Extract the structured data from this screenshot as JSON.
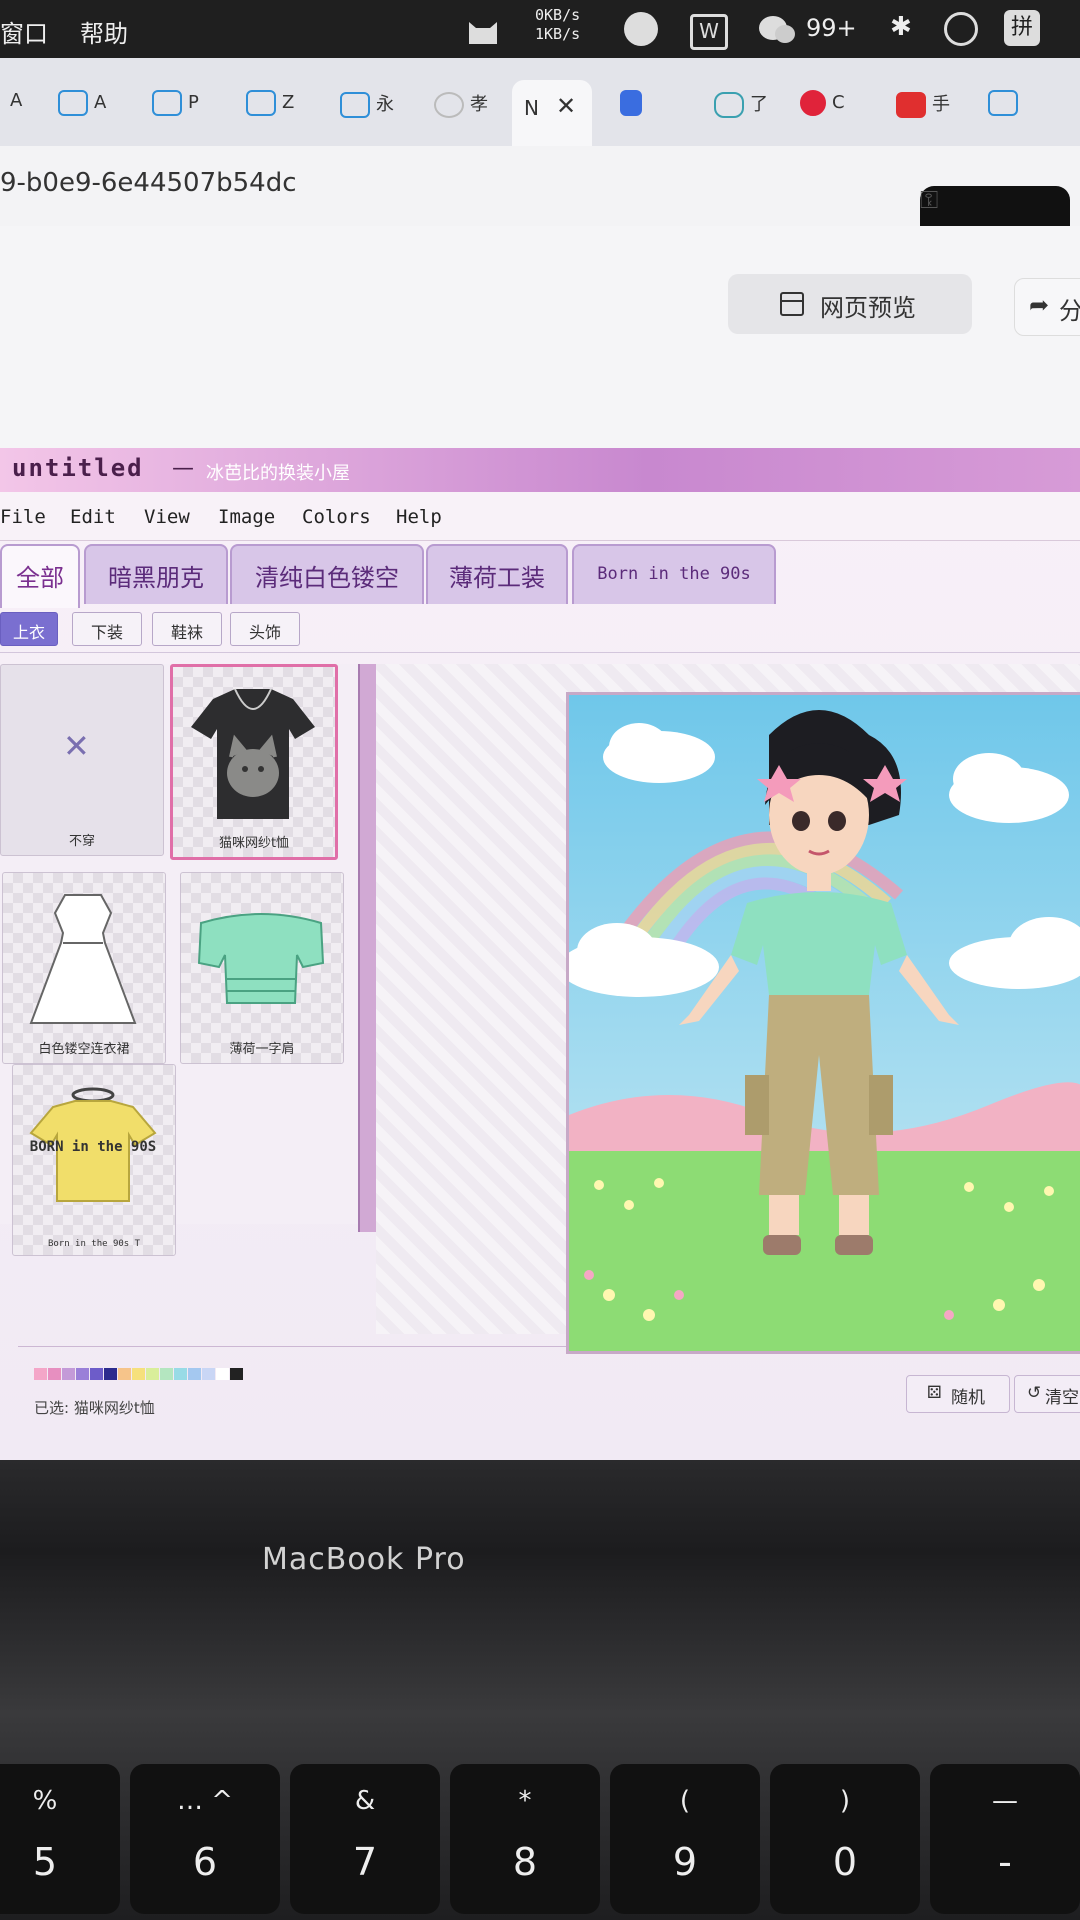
{
  "os_menu": {
    "window": "窗口",
    "help": "帮助",
    "net_up": "0KB/s",
    "net_down": "1KB/s",
    "wechat_badge": "99+",
    "ime": "拼"
  },
  "browser": {
    "tabs": [
      "A",
      "P",
      "Z",
      "永",
      "孝",
      "了",
      "C",
      "手"
    ],
    "active_tab": "N",
    "url": "9-b0e9-6e44507b54dc",
    "preview_button": "网页预览",
    "share_button": "分"
  },
  "app": {
    "title": "untitled",
    "dash": "—",
    "subtitle": "冰芭比的换装小屋",
    "menus": [
      "File",
      "Edit",
      "View",
      "Image",
      "Colors",
      "Help"
    ],
    "tabs": [
      "全部",
      "暗黑朋克",
      "清纯白色镂空",
      "薄荷工装",
      "Born in the 90s"
    ],
    "subtabs": [
      "上衣",
      "下装",
      "鞋袜",
      "头饰"
    ],
    "items": [
      {
        "label": "不穿",
        "icon": "none-x-icon"
      },
      {
        "label": "猫咪网纱t恤",
        "icon": "cat-tshirt-icon",
        "selected": true
      },
      {
        "label": "白色镂空连衣裙",
        "icon": "white-lace-dress-icon"
      },
      {
        "label": "薄荷一字肩",
        "icon": "mint-off-shoulder-top-icon"
      },
      {
        "label": "Born in the 90s T",
        "icon": "born-90s-tshirt-icon"
      }
    ],
    "tshirt_print": "BORN in the 90S",
    "status": {
      "selected": "已选: 猫咪网纱t恤"
    },
    "buttons": {
      "random": "随机",
      "clear": "清空"
    },
    "palette": [
      "#f4a6c8",
      "#e78fc0",
      "#c49ad8",
      "#9a7fd8",
      "#6d5cc9",
      "#2c2b8e",
      "#f6c48a",
      "#f6e07c",
      "#d9ee9a",
      "#b4e6c0",
      "#98dbe6",
      "#a4c8f0",
      "#c9d6f5",
      "#ffffff",
      "#222222"
    ]
  },
  "laptop": {
    "brand": "MacBook Pro",
    "keys": [
      {
        "top": "%",
        "bottom": "5"
      },
      {
        "top": "… ^",
        "bottom": "6"
      },
      {
        "top": "&",
        "bottom": "7"
      },
      {
        "top": "*",
        "bottom": "8"
      },
      {
        "top": "(",
        "bottom": "9"
      },
      {
        "top": ")",
        "bottom": "0"
      },
      {
        "top": "—",
        "bottom": "-"
      }
    ]
  }
}
